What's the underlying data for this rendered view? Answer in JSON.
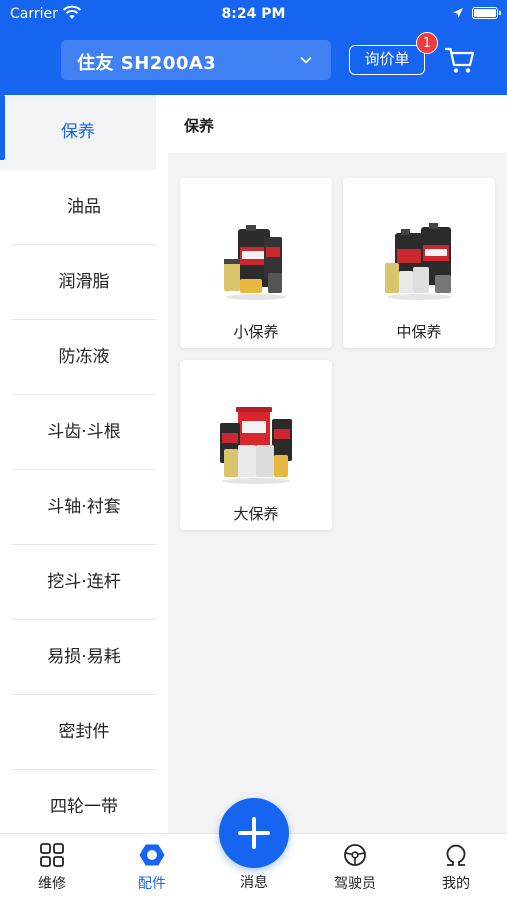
{
  "status_bar": {
    "carrier": "Carrier",
    "time": "8:24 PM"
  },
  "header": {
    "model": "住友 SH200A3",
    "inquiry_label": "询价单",
    "badge_count": "1",
    "accent_color": "#1565f0"
  },
  "sidebar": {
    "items": [
      {
        "label": "保养",
        "active": true
      },
      {
        "label": "油品"
      },
      {
        "label": "润滑脂"
      },
      {
        "label": "防冻液"
      },
      {
        "label": "斗齿·斗根"
      },
      {
        "label": "斗轴·衬套"
      },
      {
        "label": "挖斗·连杆"
      },
      {
        "label": "易损·易耗"
      },
      {
        "label": "密封件"
      },
      {
        "label": "四轮一带"
      }
    ]
  },
  "main": {
    "section_title": "保养",
    "products": [
      {
        "label": "小保养",
        "image": "oil-kit-small-image"
      },
      {
        "label": "中保养",
        "image": "oil-kit-medium-image"
      },
      {
        "label": "大保养",
        "image": "oil-kit-large-image"
      }
    ]
  },
  "tabbar": {
    "tabs": [
      {
        "label": "维修",
        "icon": "grid-icon"
      },
      {
        "label": "配件",
        "icon": "hex-nut-icon",
        "active": true
      },
      {
        "label": "消息",
        "icon": "plus-icon"
      },
      {
        "label": "驾驶员",
        "icon": "steering-wheel-icon"
      },
      {
        "label": "我的",
        "icon": "omega-icon"
      }
    ]
  }
}
